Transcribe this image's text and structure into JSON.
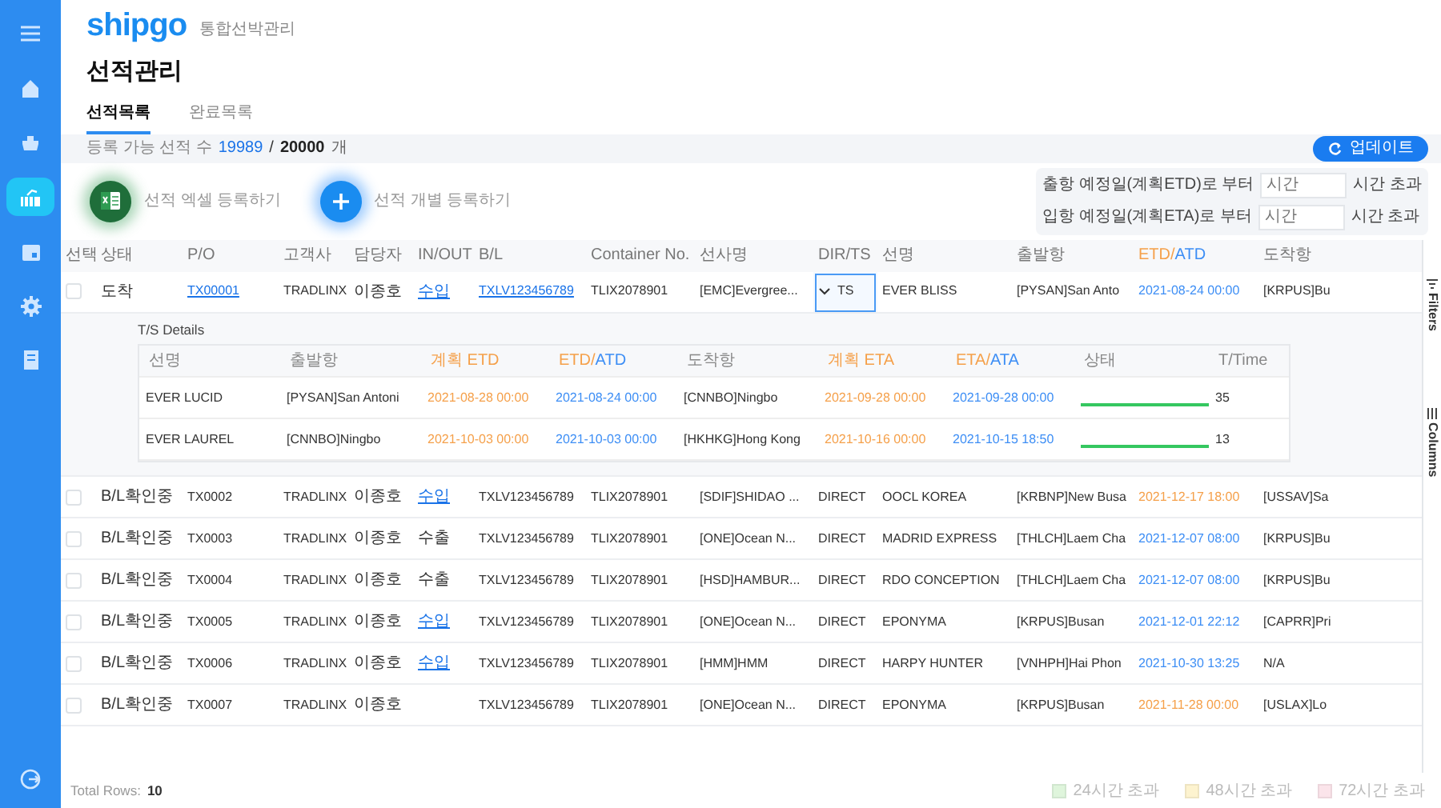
{
  "sidebar": {
    "items": [
      {
        "selected": false
      },
      {
        "selected": false
      },
      {
        "selected": false
      },
      {
        "selected": true
      },
      {
        "selected": false
      },
      {
        "selected": false
      },
      {
        "selected": false
      }
    ]
  },
  "header": {
    "logo": "shipgo",
    "subtitle": "통합선박관리"
  },
  "title": "선적관리",
  "tabs": [
    {
      "label": "선적목록",
      "selected": true
    },
    {
      "label": "완료목록",
      "selected": false
    }
  ],
  "info_bar": {
    "label": "등록 가능 선적 수",
    "available": "19989",
    "separator": "/",
    "total": "20000",
    "unit": "개",
    "update_button": "업데이트"
  },
  "actions": [
    {
      "kind": "excel",
      "label": "선적 엑셀 등록하기"
    },
    {
      "kind": "add",
      "label": "선적 개별 등록하기"
    }
  ],
  "filters": [
    {
      "label": "출항 예정일(계획ETD)로 부터",
      "placeholder": "시간",
      "suffix": "시간 초과"
    },
    {
      "label": "입항 예정일(계획ETA)로 부터",
      "placeholder": "시간",
      "suffix": "시간 초과"
    }
  ],
  "table": {
    "columns": [
      {
        "label": "선택"
      },
      {
        "label": "상태"
      },
      {
        "label": "P/O"
      },
      {
        "label": "고객사"
      },
      {
        "label": "담당자"
      },
      {
        "label": "IN/OUT"
      },
      {
        "label": "B/L"
      },
      {
        "label": "Container No."
      },
      {
        "label": "선사명"
      },
      {
        "label": "DIR/TS"
      },
      {
        "label": "선명"
      },
      {
        "label": "출발항"
      },
      {
        "parts": [
          {
            "text": "ETD/",
            "kind": "planned"
          },
          {
            "text": "ATD",
            "kind": "actual"
          }
        ]
      },
      {
        "label": "도착항"
      }
    ],
    "rows": [
      {
        "checked": false,
        "status": "도착",
        "po": {
          "text": "TX00001",
          "link": true
        },
        "customer": "TRADLINX",
        "manager": "이종호",
        "inout": {
          "text": "수입",
          "link": true
        },
        "bl": {
          "text": "TXLV123456789",
          "link": true
        },
        "container": "TLIX2078901",
        "carrier": "[EMC]Evergree...",
        "dir": {
          "text": "TS",
          "expandable": true,
          "selected": true
        },
        "vessel": "EVER BLISS",
        "departure": "[PYSAN]San Anto",
        "etd": {
          "text": "2021-08-24 00:00",
          "kind": "actual"
        },
        "arrival": "[KRPUS]Bu",
        "expanded": true,
        "details": {
          "title": "T/S Details",
          "columns": [
            {
              "label": "선명"
            },
            {
              "label": "출발항"
            },
            {
              "parts": [
                {
                  "text": "계획 ETD",
                  "kind": "planned"
                }
              ]
            },
            {
              "parts": [
                {
                  "text": "ETD/",
                  "kind": "planned"
                },
                {
                  "text": "ATD",
                  "kind": "actual"
                }
              ]
            },
            {
              "label": "도착항"
            },
            {
              "parts": [
                {
                  "text": "계획 ETA",
                  "kind": "planned"
                }
              ]
            },
            {
              "parts": [
                {
                  "text": "ETA/",
                  "kind": "planned"
                },
                {
                  "text": "ATA",
                  "kind": "actual"
                }
              ]
            },
            {
              "label": "상태"
            },
            {
              "label": "T/Time"
            }
          ],
          "rows": [
            {
              "vessel": "EVER LUCID",
              "departure": "[PYSAN]San Antoni",
              "planned_etd": "2021-08-28 00:00",
              "etd": "2021-08-24 00:00",
              "arrival": "[CNNBO]Ningbo",
              "planned_eta": "2021-09-28 00:00",
              "eta": "2021-09-28 00:00",
              "level": 1.0,
              "time": "35"
            },
            {
              "vessel": "EVER LAUREL",
              "departure": "[CNNBO]Ningbo",
              "planned_etd": "2021-10-03 00:00",
              "etd": "2021-10-03 00:00",
              "arrival": "[HKHKG]Hong Kong",
              "planned_eta": "2021-10-16 00:00",
              "eta": "2021-10-15 18:50",
              "level": 1.0,
              "time": "13"
            }
          ]
        }
      },
      {
        "checked": false,
        "status": "B/L확인중",
        "po": {
          "text": "TX0002",
          "link": false
        },
        "customer": "TRADLINX",
        "manager": "이종호",
        "inout": {
          "text": "수입",
          "link": true
        },
        "bl": {
          "text": "TXLV123456789",
          "link": false
        },
        "container": "TLIX2078901",
        "carrier": "[SDIF]SHIDAO ...",
        "dir": {
          "text": "DIRECT",
          "expandable": false,
          "selected": false
        },
        "vessel": "OOCL KOREA",
        "departure": "[KRBNP]New Busa",
        "etd": {
          "text": "2021-12-17 18:00",
          "kind": "planned"
        },
        "arrival": "[USSAV]Sa"
      },
      {
        "checked": false,
        "status": "B/L확인중",
        "po": {
          "text": "TX0003",
          "link": false
        },
        "customer": "TRADLINX",
        "manager": "이종호",
        "inout": {
          "text": "수출",
          "link": false
        },
        "bl": {
          "text": "TXLV123456789",
          "link": false
        },
        "container": "TLIX2078901",
        "carrier": "[ONE]Ocean N...",
        "dir": {
          "text": "DIRECT",
          "expandable": false,
          "selected": false
        },
        "vessel": "MADRID EXPRESS",
        "departure": "[THLCH]Laem Cha",
        "etd": {
          "text": "2021-12-07 08:00",
          "kind": "actual"
        },
        "arrival": "[KRPUS]Bu"
      },
      {
        "checked": false,
        "status": "B/L확인중",
        "po": {
          "text": "TX0004",
          "link": false
        },
        "customer": "TRADLINX",
        "manager": "이종호",
        "inout": {
          "text": "수출",
          "link": false
        },
        "bl": {
          "text": "TXLV123456789",
          "link": false
        },
        "container": "TLIX2078901",
        "carrier": "[HSD]HAMBUR...",
        "dir": {
          "text": "DIRECT",
          "expandable": false,
          "selected": false
        },
        "vessel": "RDO CONCEPTION",
        "departure": "[THLCH]Laem Cha",
        "etd": {
          "text": "2021-12-07 08:00",
          "kind": "actual"
        },
        "arrival": "[KRPUS]Bu"
      },
      {
        "checked": false,
        "status": "B/L확인중",
        "po": {
          "text": "TX0005",
          "link": false
        },
        "customer": "TRADLINX",
        "manager": "이종호",
        "inout": {
          "text": "수입",
          "link": true
        },
        "bl": {
          "text": "TXLV123456789",
          "link": false
        },
        "container": "TLIX2078901",
        "carrier": "[ONE]Ocean N...",
        "dir": {
          "text": "DIRECT",
          "expandable": false,
          "selected": false
        },
        "vessel": "EPONYMA",
        "departure": "[KRPUS]Busan",
        "etd": {
          "text": "2021-12-01 22:12",
          "kind": "actual"
        },
        "arrival": "[CAPRR]Pri"
      },
      {
        "checked": false,
        "status": "B/L확인중",
        "po": {
          "text": "TX0006",
          "link": false
        },
        "customer": "TRADLINX",
        "manager": "이종호",
        "inout": {
          "text": "수입",
          "link": true
        },
        "bl": {
          "text": "TXLV123456789",
          "link": false
        },
        "container": "TLIX2078901",
        "carrier": "[HMM]HMM",
        "dir": {
          "text": "DIRECT",
          "expandable": false,
          "selected": false
        },
        "vessel": "HARPY HUNTER",
        "departure": "[VNHPH]Hai Phon",
        "etd": {
          "text": "2021-10-30 13:25",
          "kind": "actual"
        },
        "arrival": "N/A"
      },
      {
        "checked": false,
        "status": "B/L확인중",
        "po": {
          "text": "TX0007",
          "link": false
        },
        "customer": "TRADLINX",
        "manager": "이종호",
        "bl": {
          "text": "TXLV123456789",
          "link": false
        },
        "container": "TLIX2078901",
        "carrier": "[ONE]Ocean N...",
        "dir": {
          "text": "DIRECT",
          "expandable": false,
          "selected": false
        },
        "vessel": "EPONYMA",
        "departure": "[KRPUS]Busan",
        "etd": {
          "text": "2021-11-28 00:00",
          "kind": "planned"
        },
        "arrival": "[USLAX]Lo"
      }
    ]
  },
  "side_tabs": [
    {
      "label": "Filters"
    },
    {
      "label": "Columns"
    }
  ],
  "footer": {
    "label": "Total Rows:",
    "count": "10",
    "legend": [
      {
        "label": "24시간 초과",
        "color": "#dff5dc"
      },
      {
        "label": "48시간 초과",
        "color": "#fdf3cf"
      },
      {
        "label": "72시간 초과",
        "color": "#fbe4ea"
      }
    ]
  }
}
